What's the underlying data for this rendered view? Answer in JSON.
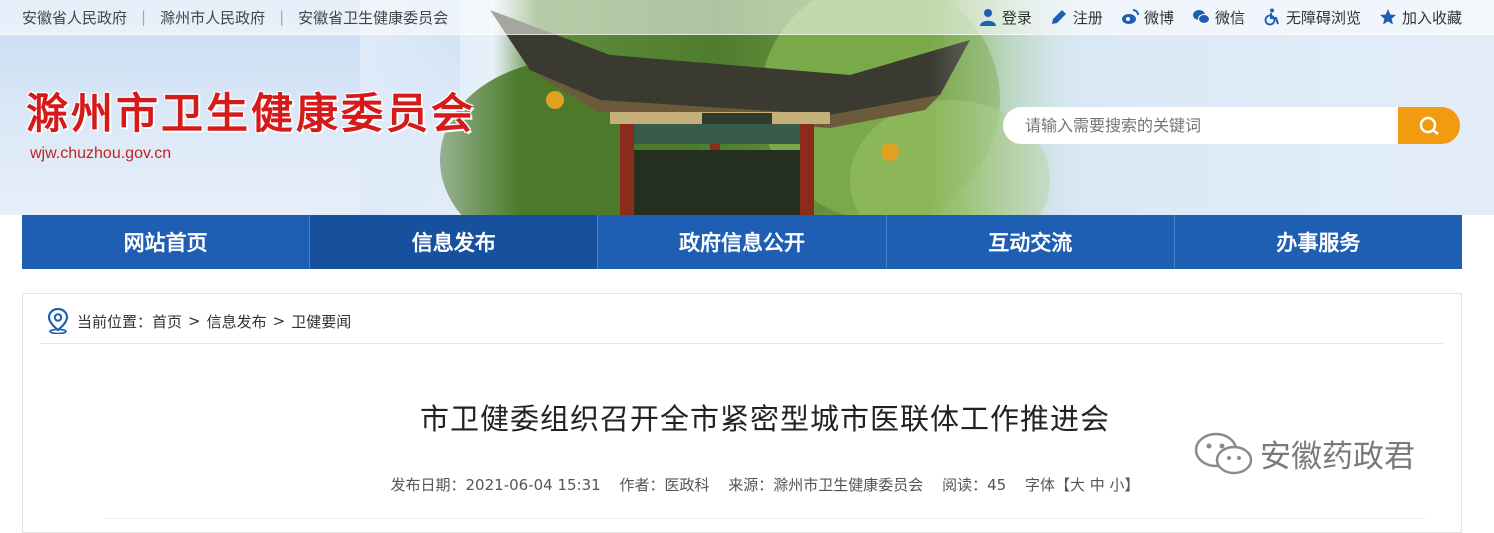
{
  "top_links": [
    "安徽省人民政府",
    "滁州市人民政府",
    "安徽省卫生健康委员会"
  ],
  "toolbar": {
    "login": "登录",
    "register": "注册",
    "weibo": "微博",
    "wechat": "微信",
    "accessible": "无障碍浏览",
    "favorite": "加入收藏"
  },
  "site": {
    "title": "滁州市卫生健康委员会",
    "url": "wjw.chuzhou.gov.cn"
  },
  "search": {
    "placeholder": "请输入需要搜索的关键词"
  },
  "nav": [
    {
      "label": "网站首页",
      "active": false
    },
    {
      "label": "信息发布",
      "active": true
    },
    {
      "label": "政府信息公开",
      "active": false
    },
    {
      "label": "互动交流",
      "active": false
    },
    {
      "label": "办事服务",
      "active": false
    }
  ],
  "breadcrumb": {
    "prefix": "当前位置：",
    "items": [
      "首页",
      "信息发布",
      "卫健要闻"
    ],
    "separator": ">"
  },
  "article": {
    "title": "市卫健委组织召开全市紧密型城市医联体工作推进会",
    "meta": {
      "date": "发布日期：2021-06-04 15:31",
      "author": "作者：医政科",
      "source": "来源：滁州市卫生健康委员会",
      "reads": "阅读：45",
      "font_size": "字体【大 中 小】"
    }
  },
  "watermark": "安徽药政君",
  "colors": {
    "nav_bg": "#1e5fb3",
    "title_red": "#d51a1a",
    "search_button": "#f29a10"
  }
}
